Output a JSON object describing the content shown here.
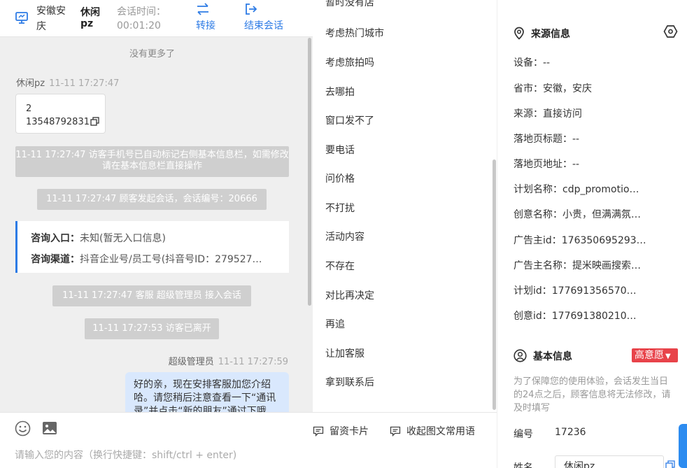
{
  "header": {
    "visitor_location": "安徽安庆",
    "visitor_name": "休闲pz",
    "session_time_label": "会话时间：",
    "session_time": "00:01:20",
    "transfer_label": "转接",
    "end_label": "结束会话"
  },
  "chat": {
    "no_more": "没有更多了",
    "visitor_msg": {
      "sender": "休闲pz",
      "time": "11-11 17:27:47",
      "line1": "2",
      "line2": "13548792831"
    },
    "system_1": "11-11 17:27:47 访客手机号已自动标记右侧基本信息栏，如需修改请在基本信息栏直接操作",
    "system_2": "11-11 17:27:47 顾客发起会话，会话编号：20666",
    "entry_label": "咨询入口：",
    "entry_value": "未知(暂无入口信息)",
    "channel_label": "咨询渠道：",
    "channel_value": "抖音企业号/员工号(抖音号ID：279527…",
    "system_3": "11-11 17:27:47 客服 超级管理员 接入会话",
    "system_4": "11-11 17:27:53 访客已离开",
    "agent_msg": {
      "sender": "超级管理员",
      "time": "11-11 17:27:59",
      "text": "好的亲，现在安排客服加您介绍哈。请您稍后注意查看一下“通讯录”并点击“新的朋友”通过下哦"
    }
  },
  "composer": {
    "card_label": "留资卡片",
    "collapse_label": "收起图文常用语",
    "placeholder": "请输入您的内容（换行快捷键：shift/ctrl + enter)"
  },
  "phrases": [
    "暂时没有店",
    "考虑热门城市",
    "考虑旅拍吗",
    "去哪拍",
    "窗口发不了",
    "要电话",
    "问价格",
    "不打扰",
    "活动内容",
    "不存在",
    "对比再决定",
    "再追",
    "让加客服",
    "拿到联系后"
  ],
  "source": {
    "title": "来源信息",
    "device": "设备：--",
    "province": "省市：安徽，安庆",
    "origin": "来源：直接访问",
    "landing_title": "落地页标题：--",
    "landing_url": "落地页地址：--",
    "plan_name": "计划名称：cdp_promotio…",
    "creative_name": "创意名称：小贵，但满满氛…",
    "advertiser_id": "广告主id：176350695293…",
    "advertiser_name": "广告主名称：提米映画搜索…",
    "plan_id": "计划id：177691356570…",
    "creative_id": "创意id：177691380210…"
  },
  "basic": {
    "title": "基本信息",
    "intent": "高意愿",
    "notice": "为了保障您的使用体验，会话发生当日的24点之后，顾客信息将无法修改，请及时填写",
    "id_label": "编号",
    "id_value": "17236",
    "name_label": "姓名",
    "name_value": "休闲pz"
  },
  "colors": {
    "accent": "#2d7be5",
    "intent_badge": "#e8434a",
    "agent_bubble": "#d9e8fd",
    "system_bg": "#cfcfcf"
  }
}
